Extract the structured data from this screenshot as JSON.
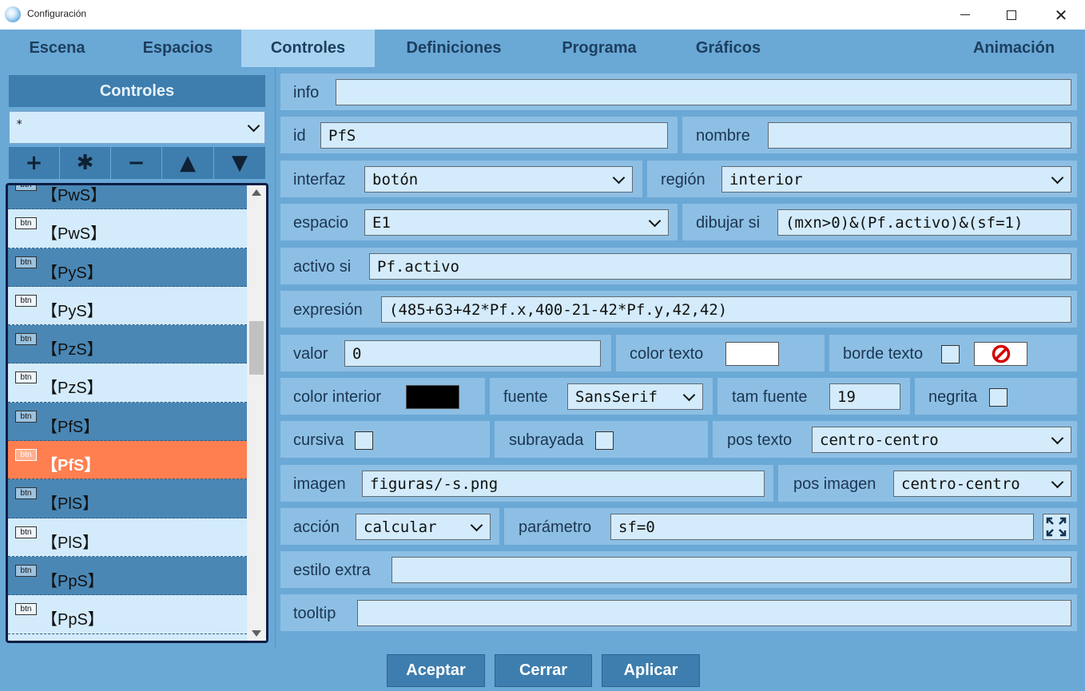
{
  "window": {
    "title": "Configuración"
  },
  "tabs": [
    "Escena",
    "Espacios",
    "Controles",
    "Definiciones",
    "Programa",
    "Gráficos",
    "Animación"
  ],
  "active_tab": "Controles",
  "left": {
    "header": "Controles",
    "filter_value": "*",
    "tools": [
      "+",
      "✱",
      "−",
      "▲",
      "▼"
    ],
    "items": [
      {
        "icon_text": "btn",
        "label": "【PwS】"
      },
      {
        "icon_text": "btn",
        "label": "【PwS】"
      },
      {
        "icon_text": "btn",
        "label": "【PyS】"
      },
      {
        "icon_text": "btn",
        "label": "【PyS】"
      },
      {
        "icon_text": "btn",
        "label": "【PzS】"
      },
      {
        "icon_text": "btn",
        "label": "【PzS】"
      },
      {
        "icon_text": "btn",
        "label": "【PfS】"
      },
      {
        "icon_text": "btn",
        "label": "【PfS】"
      },
      {
        "icon_text": "btn",
        "label": "【PlS】"
      },
      {
        "icon_text": "btn",
        "label": "【PlS】"
      },
      {
        "icon_text": "btn",
        "label": "【PpS】"
      },
      {
        "icon_text": "btn",
        "label": "【PpS】"
      }
    ]
  },
  "form": {
    "info": {
      "label": "info",
      "value": ""
    },
    "id": {
      "label": "id",
      "value": "PfS"
    },
    "nombre": {
      "label": "nombre",
      "value": ""
    },
    "interfaz": {
      "label": "interfaz",
      "value": "botón"
    },
    "region": {
      "label": "región",
      "value": "interior"
    },
    "espacio": {
      "label": "espacio",
      "value": "E1"
    },
    "dibujar_si": {
      "label": "dibujar si",
      "value": "(mxn>0)&(Pf.activo)&(sf=1)"
    },
    "activo_si": {
      "label": "activo si",
      "value": "Pf.activo"
    },
    "expresion": {
      "label": "expresión",
      "value": "(485+63+42*Pf.x,400-21-42*Pf.y,42,42)"
    },
    "valor": {
      "label": "valor",
      "value": "0"
    },
    "color_texto": {
      "label": "color texto",
      "color": "#ffffff"
    },
    "borde_texto": {
      "label": "borde texto",
      "checked": false,
      "icon": "no-symbol-icon"
    },
    "color_interior": {
      "label": "color interior",
      "color": "#000000"
    },
    "fuente": {
      "label": "fuente",
      "value": "SansSerif"
    },
    "tam_fuente": {
      "label": "tam fuente",
      "value": "19"
    },
    "negrita": {
      "label": "negrita",
      "checked": false
    },
    "cursiva": {
      "label": "cursiva",
      "checked": false
    },
    "subrayada": {
      "label": "subrayada",
      "checked": false
    },
    "pos_texto": {
      "label": "pos texto",
      "value": "centro-centro"
    },
    "imagen": {
      "label": "imagen",
      "value": "figuras/-s.png"
    },
    "pos_imagen": {
      "label": "pos imagen",
      "value": "centro-centro"
    },
    "accion": {
      "label": "acción",
      "value": "calcular"
    },
    "parametro": {
      "label": "parámetro",
      "value": "sf=0",
      "icon": "expand-icon"
    },
    "estilo_extra": {
      "label": "estilo extra",
      "value": ""
    },
    "tooltip": {
      "label": "tooltip",
      "value": ""
    }
  },
  "buttons": {
    "accept": "Aceptar",
    "close": "Cerrar",
    "apply": "Aplicar"
  },
  "colors": {
    "panel_bg": "#6aa8d6",
    "field_bg": "#d3ebfb",
    "accent": "#3e7eae",
    "selected": "#ff7f50",
    "row_dark": "#4a87b5"
  }
}
